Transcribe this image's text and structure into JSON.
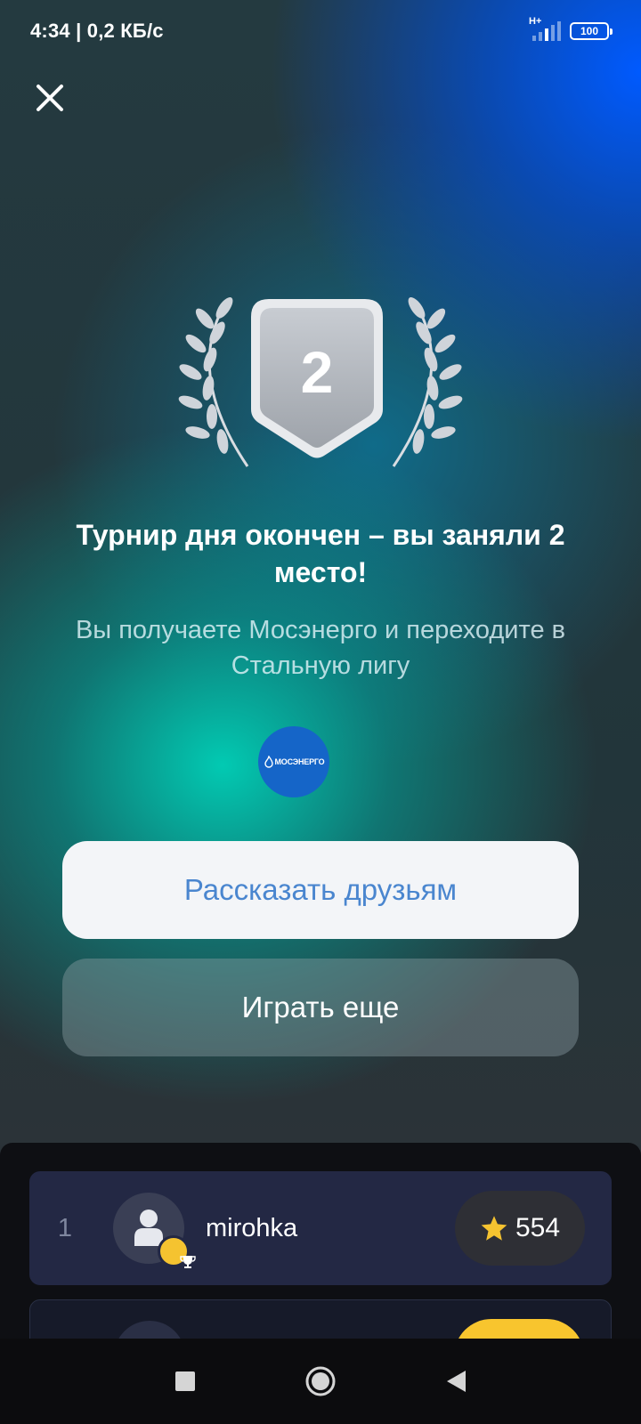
{
  "status_bar": {
    "time_speed": "4:34 | 0,2 КБ/с",
    "network": "H+",
    "battery": "100"
  },
  "result": {
    "place_badge": "2",
    "title": "Турнир дня окончен – вы заняли 2 место!",
    "subtitle": "Вы получаете Мосэнерго и переходите в Стальную лигу",
    "reward_logo_text": "МОСЭНЕРГО"
  },
  "buttons": {
    "share_label": "Рассказать друзьям",
    "play_again_label": "Играть еще"
  },
  "leaderboard": [
    {
      "rank": "1",
      "name": "mirohka",
      "score": "554"
    }
  ],
  "colors": {
    "share_text": "#4a86cf",
    "score_pill": "#2e2f35",
    "star": "#f5c330",
    "row_bg": "#232844"
  },
  "icons": {
    "close": "close-icon",
    "star": "star-icon",
    "trophy": "trophy-icon",
    "nav_recent": "square-icon",
    "nav_home": "circle-icon",
    "nav_back": "triangle-back-icon"
  }
}
